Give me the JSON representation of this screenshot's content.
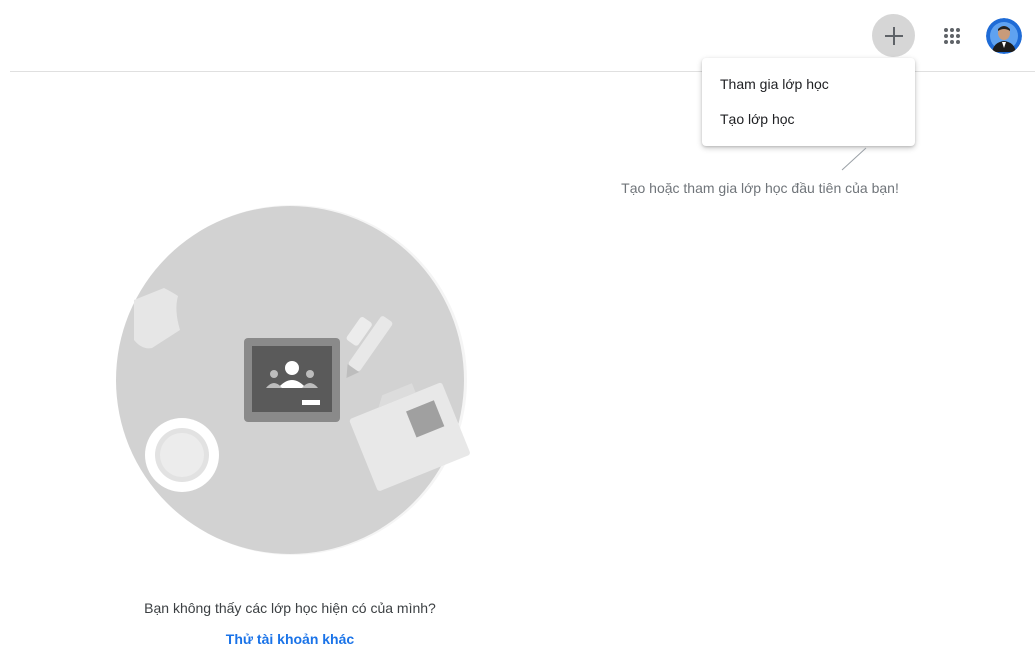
{
  "header": {
    "create_join_icon": "plus-icon",
    "apps_icon": "apps-grid-icon",
    "avatar_icon": "user-avatar"
  },
  "menu": {
    "items": [
      {
        "label": "Tham gia lớp học"
      },
      {
        "label": "Tạo lớp học"
      }
    ]
  },
  "main": {
    "hint": "Tạo hoặc tham gia lớp học đầu tiên của bạn!",
    "no_class_text": "Bạn không thấy các lớp học hiện có của mình?",
    "try_other_account": "Thử tài khoản khác"
  },
  "colors": {
    "accent": "#1a73e8",
    "illustration_gray": "#cfcfcf"
  }
}
